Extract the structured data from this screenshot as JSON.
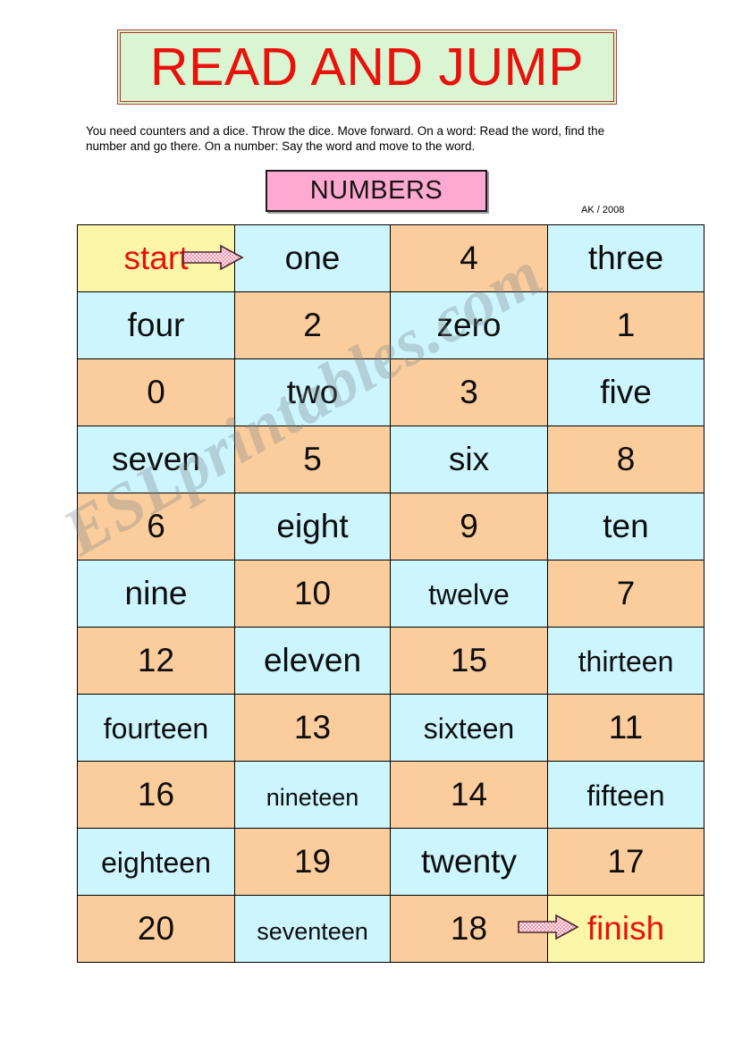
{
  "title": {
    "text": "READ AND JUMP",
    "bg_color": "#d9f5d2",
    "text_color": "#e8120b",
    "border_color": "#c0392b"
  },
  "instructions": {
    "text": "You need counters and a dice. Throw the dice. Move forward. On a word: Read the word, find the number and go there. On a number: Say the word and move to the word."
  },
  "subtitle": {
    "text": "NUMBERS",
    "bg_color": "#ffa9d2",
    "border_color": "#1a1a1a"
  },
  "credit": {
    "text": "AK / 2008"
  },
  "watermark": {
    "text": "ESLprintables.com"
  },
  "legend": {
    "cyan": "#ccf5fd",
    "orange": "#fbcc9c",
    "yellow": "#fcf6a8",
    "accent_text": "#e8120b"
  },
  "board": {
    "columns": 4,
    "rows": 11,
    "cells": [
      [
        {
          "text": "start",
          "fill": "yellow",
          "accent": true,
          "size": "normal"
        },
        {
          "text": "one",
          "fill": "cyan",
          "accent": false,
          "size": "normal"
        },
        {
          "text": "4",
          "fill": "orange",
          "accent": false,
          "size": "normal"
        },
        {
          "text": "three",
          "fill": "cyan",
          "accent": false,
          "size": "normal"
        }
      ],
      [
        {
          "text": "four",
          "fill": "cyan",
          "accent": false,
          "size": "normal"
        },
        {
          "text": "2",
          "fill": "orange",
          "accent": false,
          "size": "normal"
        },
        {
          "text": "zero",
          "fill": "cyan",
          "accent": false,
          "size": "normal"
        },
        {
          "text": "1",
          "fill": "orange",
          "accent": false,
          "size": "normal"
        }
      ],
      [
        {
          "text": "0",
          "fill": "orange",
          "accent": false,
          "size": "normal"
        },
        {
          "text": "two",
          "fill": "cyan",
          "accent": false,
          "size": "normal"
        },
        {
          "text": "3",
          "fill": "orange",
          "accent": false,
          "size": "normal"
        },
        {
          "text": "five",
          "fill": "cyan",
          "accent": false,
          "size": "normal"
        }
      ],
      [
        {
          "text": "seven",
          "fill": "cyan",
          "accent": false,
          "size": "normal"
        },
        {
          "text": "5",
          "fill": "orange",
          "accent": false,
          "size": "normal"
        },
        {
          "text": "six",
          "fill": "cyan",
          "accent": false,
          "size": "normal"
        },
        {
          "text": "8",
          "fill": "orange",
          "accent": false,
          "size": "normal"
        }
      ],
      [
        {
          "text": "6",
          "fill": "orange",
          "accent": false,
          "size": "normal"
        },
        {
          "text": "eight",
          "fill": "cyan",
          "accent": false,
          "size": "normal"
        },
        {
          "text": "9",
          "fill": "orange",
          "accent": false,
          "size": "normal"
        },
        {
          "text": "ten",
          "fill": "cyan",
          "accent": false,
          "size": "normal"
        }
      ],
      [
        {
          "text": "nine",
          "fill": "cyan",
          "accent": false,
          "size": "normal"
        },
        {
          "text": "10",
          "fill": "orange",
          "accent": false,
          "size": "normal"
        },
        {
          "text": "twelve",
          "fill": "cyan",
          "accent": false,
          "size": "medium"
        },
        {
          "text": "7",
          "fill": "orange",
          "accent": false,
          "size": "normal"
        }
      ],
      [
        {
          "text": "12",
          "fill": "orange",
          "accent": false,
          "size": "normal"
        },
        {
          "text": "eleven",
          "fill": "cyan",
          "accent": false,
          "size": "normal"
        },
        {
          "text": "15",
          "fill": "orange",
          "accent": false,
          "size": "normal"
        },
        {
          "text": "thirteen",
          "fill": "cyan",
          "accent": false,
          "size": "medium"
        }
      ],
      [
        {
          "text": "fourteen",
          "fill": "cyan",
          "accent": false,
          "size": "medium"
        },
        {
          "text": "13",
          "fill": "orange",
          "accent": false,
          "size": "normal"
        },
        {
          "text": "sixteen",
          "fill": "cyan",
          "accent": false,
          "size": "medium"
        },
        {
          "text": "11",
          "fill": "orange",
          "accent": false,
          "size": "normal"
        }
      ],
      [
        {
          "text": "16",
          "fill": "orange",
          "accent": false,
          "size": "normal"
        },
        {
          "text": "nineteen",
          "fill": "cyan",
          "accent": false,
          "size": "small"
        },
        {
          "text": "14",
          "fill": "orange",
          "accent": false,
          "size": "normal"
        },
        {
          "text": "fifteen",
          "fill": "cyan",
          "accent": false,
          "size": "medium"
        }
      ],
      [
        {
          "text": "eighteen",
          "fill": "cyan",
          "accent": false,
          "size": "medium"
        },
        {
          "text": "19",
          "fill": "orange",
          "accent": false,
          "size": "normal"
        },
        {
          "text": "twenty",
          "fill": "cyan",
          "accent": false,
          "size": "normal"
        },
        {
          "text": "17",
          "fill": "orange",
          "accent": false,
          "size": "normal"
        }
      ],
      [
        {
          "text": "20",
          "fill": "orange",
          "accent": false,
          "size": "normal"
        },
        {
          "text": "seventeen",
          "fill": "cyan",
          "accent": false,
          "size": "small"
        },
        {
          "text": "18",
          "fill": "orange",
          "accent": false,
          "size": "normal"
        },
        {
          "text": "finish",
          "fill": "yellow",
          "accent": true,
          "size": "normal"
        }
      ]
    ]
  }
}
